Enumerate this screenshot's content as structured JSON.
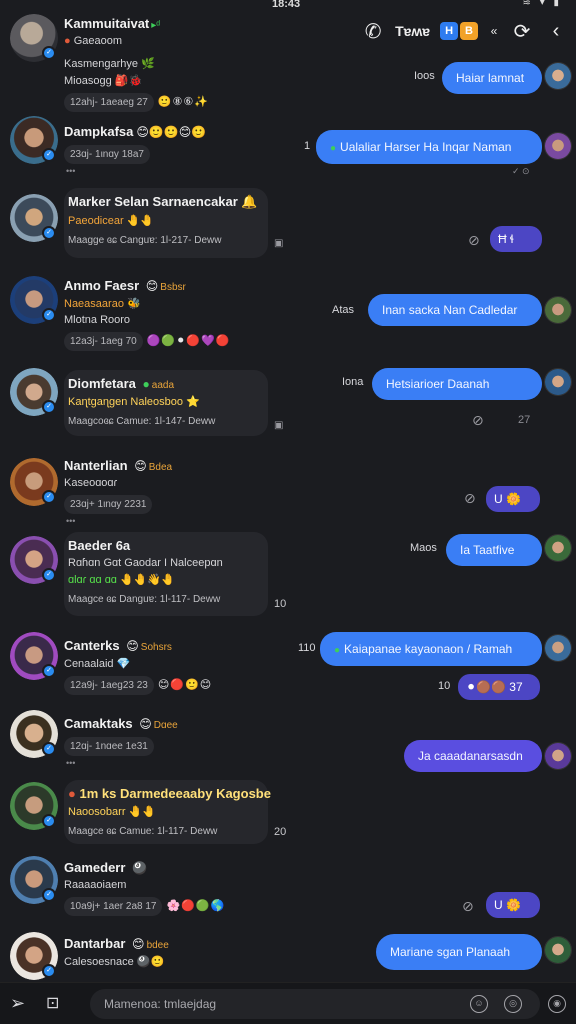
{
  "status": {
    "time": "18:43",
    "icons": "≋ ▾ ▮"
  },
  "header": {
    "phone_icon": "phone-icon",
    "title": "Tɐʍɐ",
    "badge1": "H",
    "badge2": "B",
    "more": "«",
    "refresh_icon": "refresh-icon",
    "back_icon": "back-icon"
  },
  "chats": [
    {
      "name": "Kammuitaivat",
      "tag": "▸ᵈ",
      "sub": "Gaeaoom",
      "line2": "Kasmengarhye 🌿",
      "line3": "Mioasogg 🎒🐞",
      "meta": "12ahj- 1aeaeg 27",
      "reactions": "🙂⑧⑥✨"
    },
    {
      "name": "Dampkafsa",
      "emoji": "😊🙂🙂😊🙂",
      "meta": "23ɑj- 1ιnɑy 18a7"
    },
    {
      "name": "Marker Selan  Sarnaencakar 🔔",
      "sub": "Paeodicear 🤚🤚",
      "meta": "Maagge ɞɕ Canguɐ: 1l-217- Deww"
    },
    {
      "name": "Anmo Faesr",
      "tag": "Bsbsr",
      "sub": "Naeasaarao 🐝",
      "line3": "Mlotna Rooro",
      "meta": "12a3j- 1aeg 70",
      "reactions": "🟣🟢⚫🔴💜🔴"
    },
    {
      "name": "Diomfetara",
      "tag": "aada",
      "sub": "Kaɳtgaɳgen Naleosboo ⭐",
      "meta": "Maagcoɞɕ Camue: 1l-147- Deww"
    },
    {
      "name": "Nanterlian",
      "tag": "Bdea",
      "sub": "Kaseoɑoɑɾ",
      "meta": "23ɑj+ 1ιnɑy 2231"
    },
    {
      "name": "Baeder 6a",
      "sub": "Rɑɦɑn Gɑt Gaodar I Nalceepɑn",
      "line3": "ɑlɑɾ ɑɑ ɑɑ 🤚🤚👋🤚",
      "meta": "Maagce ɞɕ Danguɐ: 1l-117- Deww"
    },
    {
      "name": "Canterks",
      "tag": "Sohsrs",
      "sub": "Cenaalaid 💎",
      "meta": "12a9j- 1aeg23 23",
      "reactions": "😊🔴🙂😊"
    },
    {
      "name": "Camaktaks",
      "tag": "Dɑee",
      "meta": "12ɑj- 1nɑee 1e31"
    },
    {
      "name": "1m ks  Darmedeeaaby Kagosbe",
      "sub": "Naoosobarr 🤚🤚",
      "meta": "Maagce ɞɕ Camue: 1l-117- Deww"
    },
    {
      "name": "Gamederr",
      "sub": "Raaaaoiaem",
      "meta": "10a9j+ 1aer 2a8 17",
      "reactions": "🌸🔴🟢🌎"
    },
    {
      "name": "Dantarbar",
      "tag": "bdee",
      "sub": "Calesoesnace 🎱🙂"
    }
  ],
  "messages": [
    {
      "label": "Ioos",
      "text": "Haiar lamnat"
    },
    {
      "label": "1",
      "text": "Ualaliar Harser Ha Inqar Naman",
      "tick": "✓ ⊙"
    },
    {
      "text": "Ħ ɬ"
    },
    {
      "label": "Atas",
      "text": "Inan sacka Nan Cadledar"
    },
    {
      "label": "Iona",
      "text": "Hetsiarioer Daanah",
      "tick": "27"
    },
    {
      "text": "U 🌼"
    },
    {
      "label": "Maos",
      "text": "Ia Taatfive"
    },
    {
      "label": "110",
      "text": "Kaiapanae kayaonaon / Ramah",
      "count": "10",
      "tick": "37"
    },
    {
      "text": "Ja caaadanarsasdn"
    },
    {
      "text": "U 🌼"
    },
    {
      "text": "Mariane sgan Planaah"
    }
  ],
  "side_numbers": [
    "10",
    "20"
  ],
  "composer": {
    "placeholder": "Mamenoa: tmlaejdag"
  }
}
